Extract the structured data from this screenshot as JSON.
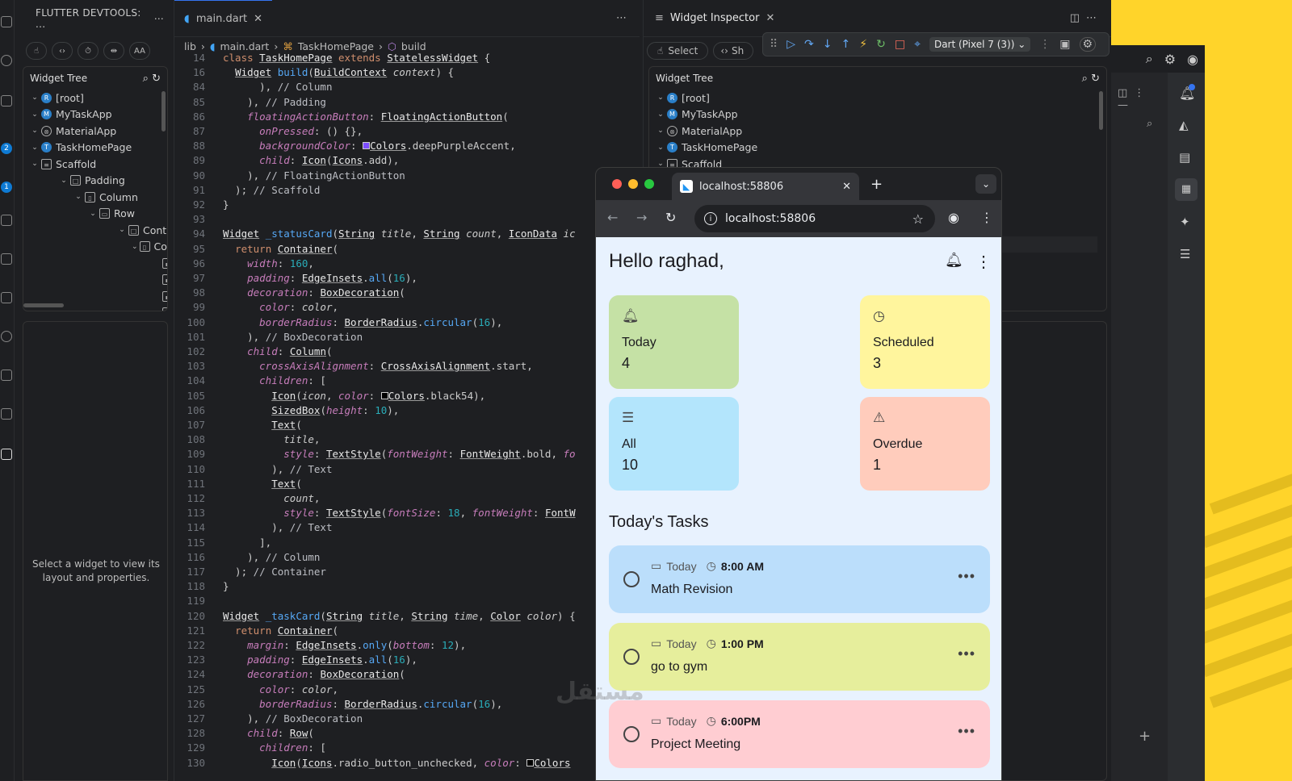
{
  "sidebar": {
    "title": "FLUTTER DEVTOOLS: ...",
    "tree_title": "Widget Tree",
    "tree": [
      {
        "label": "[root]",
        "icon": "R"
      },
      {
        "label": "MyTaskApp",
        "icon": "M"
      },
      {
        "label": "MaterialApp",
        "icon": "mat"
      },
      {
        "label": "TaskHomePage",
        "icon": "T"
      },
      {
        "label": "Scaffold",
        "icon": "scaffold"
      },
      {
        "label": "Padding",
        "icon": "box"
      },
      {
        "label": "Column",
        "icon": "col"
      },
      {
        "label": "Row",
        "icon": "row"
      },
      {
        "label": "Cont",
        "icon": "box"
      },
      {
        "label": "Colu",
        "icon": "col"
      }
    ],
    "empty_text": "Select a widget to view its layout and properties.",
    "badges": [
      "2",
      "1"
    ]
  },
  "editor": {
    "tab_label": "main.dart",
    "breadcrumb": [
      "lib",
      "main.dart",
      "TaskHomePage",
      "build"
    ],
    "sticky": [
      {
        "n": "14",
        "html": "<span class='kw'>class</span> <span class='cls'>TaskHomePage</span> <span class='kw'>extends</span> <span class='cls'>StatelessWidget</span> {"
      },
      {
        "n": "16",
        "html": "  <span class='cls'>Widget</span> <span class='fn'>build</span>(<span class='cls'>BuildContext</span> <span class='it'>context</span>) {"
      }
    ],
    "lines": [
      {
        "n": "84",
        "html": "      ), <span class='cm'>// Column</span>"
      },
      {
        "n": "85",
        "html": "    ), <span class='cm'>// Padding</span>"
      },
      {
        "n": "86",
        "html": "    <span class='pr'>floatingActionButton</span>: <span class='cls'>FloatingActionButton</span>("
      },
      {
        "n": "87",
        "html": "      <span class='pr'>onPressed</span>: () {},"
      },
      {
        "n": "88",
        "html": "      <span class='pr'>backgroundColor</span>: <span style='display:inline-block;width:9px;height:9px;background:#7c4dff;border:1px solid #ccc'></span><span class='cls'>Colors</span>.deepPurpleAccent,"
      },
      {
        "n": "89",
        "html": "      <span class='pr'>child</span>: <span class='cls'>Icon</span>(<span class='cls'>Icons</span>.add),"
      },
      {
        "n": "90",
        "html": "    ), <span class='cm'>// FloatingActionButton</span>"
      },
      {
        "n": "91",
        "html": "  ); <span class='cm'>// Scaffold</span>"
      },
      {
        "n": "92",
        "html": "}"
      },
      {
        "n": "93",
        "html": ""
      },
      {
        "n": "94",
        "html": "<span class='cls'>Widget</span> <span class='fn'>_statusCard</span>(<span class='cls'>String</span> <span class='it'>title</span>, <span class='cls'>String</span> <span class='it'>count</span>, <span class='cls'>IconData</span> <span class='it'>ic</span>"
      },
      {
        "n": "95",
        "html": "  <span class='kw'>return</span> <span class='cls'>Container</span>("
      },
      {
        "n": "96",
        "html": "    <span class='pr'>width</span>: <span class='num'>160</span>,"
      },
      {
        "n": "97",
        "html": "    <span class='pr'>padding</span>: <span class='cls'>EdgeInsets</span>.<span class='fn'>all</span>(<span class='num'>16</span>),"
      },
      {
        "n": "98",
        "html": "    <span class='pr'>decoration</span>: <span class='cls'>BoxDecoration</span>("
      },
      {
        "n": "99",
        "html": "      <span class='pr'>color</span>: <span class='it'>color</span>,"
      },
      {
        "n": "100",
        "html": "      <span class='pr'>borderRadius</span>: <span class='cls'>BorderRadius</span>.<span class='fn'>circular</span>(<span class='num'>16</span>),"
      },
      {
        "n": "101",
        "html": "    ), <span class='cm'>// BoxDecoration</span>"
      },
      {
        "n": "102",
        "html": "    <span class='pr'>child</span>: <span class='cls'>Column</span>("
      },
      {
        "n": "103",
        "html": "      <span class='pr'>crossAxisAlignment</span>: <span class='cls'>CrossAxisAlignment</span>.start,"
      },
      {
        "n": "104",
        "html": "      <span class='pr'>children</span>: ["
      },
      {
        "n": "105",
        "html": "        <span class='cls'>Icon</span>(<span class='it'>icon</span>, <span class='pr'>color</span>: <span style='display:inline-block;width:9px;height:9px;background:#000;border:1px solid #ccc'></span><span class='cls'>Colors</span>.black54),"
      },
      {
        "n": "106",
        "html": "        <span class='cls'>SizedBox</span>(<span class='pr'>height</span>: <span class='num'>10</span>),"
      },
      {
        "n": "107",
        "html": "        <span class='cls'>Text</span>("
      },
      {
        "n": "108",
        "html": "          <span class='it'>title</span>,"
      },
      {
        "n": "109",
        "html": "          <span class='pr'>style</span>: <span class='cls'>TextStyle</span>(<span class='pr'>fontWeight</span>: <span class='cls'>FontWeight</span>.bold, <span class='pr'>fo</span>"
      },
      {
        "n": "110",
        "html": "        ), <span class='cm'>// Text</span>"
      },
      {
        "n": "111",
        "html": "        <span class='cls'>Text</span>("
      },
      {
        "n": "112",
        "html": "          <span class='it'>count</span>,"
      },
      {
        "n": "113",
        "html": "          <span class='pr'>style</span>: <span class='cls'>TextStyle</span>(<span class='pr'>fontSize</span>: <span class='num'>18</span>, <span class='pr'>fontWeight</span>: <span class='cls'>FontW</span>"
      },
      {
        "n": "114",
        "html": "        ), <span class='cm'>// Text</span>"
      },
      {
        "n": "115",
        "html": "      ],"
      },
      {
        "n": "116",
        "html": "    ), <span class='cm'>// Column</span>"
      },
      {
        "n": "117",
        "html": "  ); <span class='cm'>// Container</span>"
      },
      {
        "n": "118",
        "html": "}"
      },
      {
        "n": "119",
        "html": ""
      },
      {
        "n": "120",
        "html": "<span class='cls'>Widget</span> <span class='fn'>_taskCard</span>(<span class='cls'>String</span> <span class='it'>title</span>, <span class='cls'>String</span> <span class='it'>time</span>, <span class='cls'>Color</span> <span class='it'>color</span>) {"
      },
      {
        "n": "121",
        "html": "  <span class='kw'>return</span> <span class='cls'>Container</span>("
      },
      {
        "n": "122",
        "html": "    <span class='pr'>margin</span>: <span class='cls'>EdgeInsets</span>.<span class='fn'>only</span>(<span class='pr'>bottom</span>: <span class='num'>12</span>),"
      },
      {
        "n": "123",
        "html": "    <span class='pr'>padding</span>: <span class='cls'>EdgeInsets</span>.<span class='fn'>all</span>(<span class='num'>16</span>),"
      },
      {
        "n": "124",
        "html": "    <span class='pr'>decoration</span>: <span class='cls'>BoxDecoration</span>("
      },
      {
        "n": "125",
        "html": "      <span class='pr'>color</span>: <span class='it'>color</span>,"
      },
      {
        "n": "126",
        "html": "      <span class='pr'>borderRadius</span>: <span class='cls'>BorderRadius</span>.<span class='fn'>circular</span>(<span class='num'>16</span>),"
      },
      {
        "n": "127",
        "html": "    ), <span class='cm'>// BoxDecoration</span>"
      },
      {
        "n": "128",
        "html": "    <span class='pr'>child</span>: <span class='cls'>Row</span>("
      },
      {
        "n": "129",
        "html": "      <span class='pr'>children</span>: ["
      },
      {
        "n": "130",
        "html": "        <span class='cls'>Icon</span>(<span class='cls'>Icons</span>.radio_button_unchecked, <span class='pr'>color</span>: <span style='display:inline-block;width:9px;height:9px;background:#000;border:1px solid #ccc'></span><span class='cls'>Colors</span>"
      }
    ]
  },
  "inspector": {
    "tab_label": "Widget Inspector",
    "select_label": "Select",
    "show_label": "Sh",
    "device": "Dart (Pixel 7 (3))",
    "tree_title": "Widget Tree",
    "tree": [
      {
        "label": "[root]",
        "icon": "R"
      },
      {
        "label": "MyTaskApp",
        "icon": "M"
      },
      {
        "label": "MaterialApp",
        "icon": "mat"
      },
      {
        "label": "TaskHomePage",
        "icon": "T"
      },
      {
        "label": "Scaffold",
        "icon": "scaffold"
      }
    ]
  },
  "browser": {
    "tab_title": "localhost:58806",
    "url": "localhost:58806"
  },
  "app": {
    "greeting": "Hello raghad,",
    "cards": [
      {
        "title": "Today",
        "count": "4",
        "color": "#c5e1a5",
        "icon": "bell-icon"
      },
      {
        "title": "Scheduled",
        "count": "3",
        "color": "#fff59d",
        "icon": "clock-icon"
      },
      {
        "title": "All",
        "count": "10",
        "color": "#b3e5fc",
        "icon": "list-icon"
      },
      {
        "title": "Overdue",
        "count": "1",
        "color": "#ffccbc",
        "icon": "warning-icon"
      }
    ],
    "section_title": "Today's Tasks",
    "tasks": [
      {
        "day": "Today",
        "time": "8:00 AM",
        "title": "Math Revision",
        "color": "#bbdefb"
      },
      {
        "day": "Today",
        "time": "1:00 PM",
        "title": "go to gym",
        "color": "#e6ee9c"
      },
      {
        "day": "Today",
        "time": "6:00PM",
        "title": "Project Meeting",
        "color": "#ffcdd2"
      }
    ]
  },
  "watermark": "مستقل"
}
